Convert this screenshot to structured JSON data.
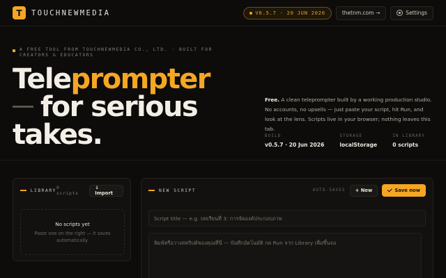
{
  "header": {
    "logo_letter": "T",
    "brand": "TOUCHNEWMEDIA",
    "version": "V0.5.7 · 20 JUN 2026",
    "site_link": "thetnm.com →",
    "settings_label": "Settings"
  },
  "hero": {
    "eyebrow": "A FREE TOOL FROM TOUCHNEWMEDIA CO., LTD. · BUILT FOR CREATORS & EDUCATORS",
    "title_part1": "Tele",
    "title_part2": "prompter",
    "title_line2": "for serious",
    "title_line3": "takes.",
    "desc_lead": "Free.",
    "desc": " A clean teleprompter built by a working production studio. No accounts, no upsells — just paste your script, hit Run, and look at the lens. Scripts live in your browser; nothing leaves this tab."
  },
  "stats": [
    {
      "label": "BUILD",
      "value": "v0.5.7 · 20 Jun 2026"
    },
    {
      "label": "STORAGE",
      "value": "localStorage"
    },
    {
      "label": "IN LIBRARY",
      "value": "0 scripts"
    }
  ],
  "library": {
    "title": "LIBRARY",
    "count": "0 scripts",
    "import_label": "↓ Import",
    "empty_title": "No scripts yet",
    "empty_hint": "Paste one on the right — it saves automatically."
  },
  "script": {
    "title": "NEW SCRIPT",
    "autosave": "AUTO-SAVES",
    "new_label": "+ New",
    "save_label": "Save now",
    "title_placeholder": "Script title — e.g. บทเรียนที่ 3: การจัดองค์ประกอบภาพ",
    "body_placeholder": "พิมพ์หรือวางสคริปต์ของคุณที่นี่ — บันทึกอัตโนมัติ กด Run จาก Library เพื่อขึ้นจอ"
  },
  "colors": {
    "accent": "#f5a623",
    "background": "#0d0c0b"
  }
}
